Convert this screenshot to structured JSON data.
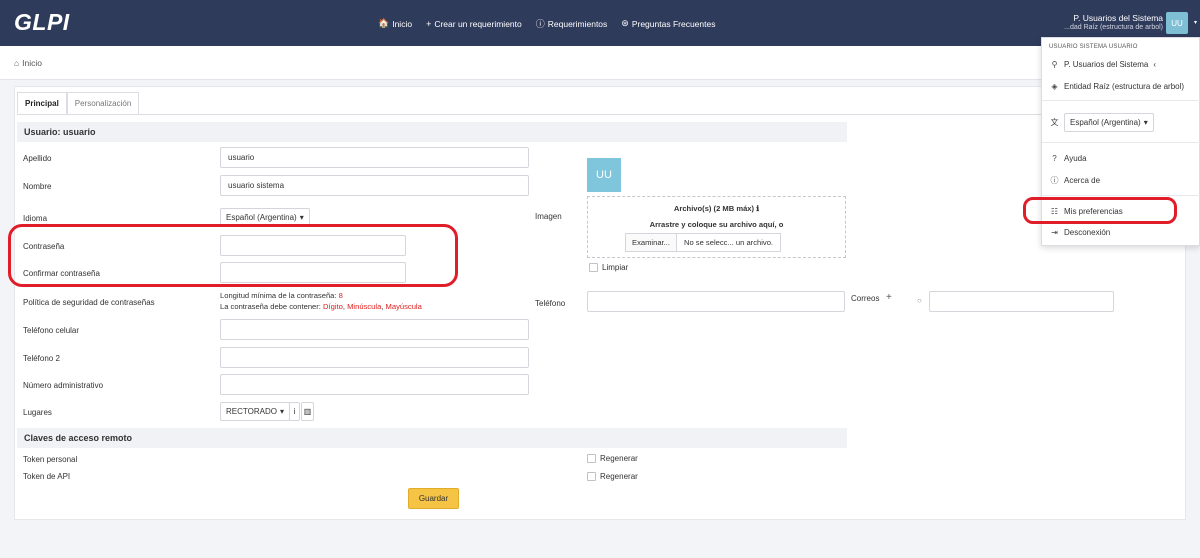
{
  "header": {
    "logo": "GLPI",
    "nav": [
      {
        "icon": "home-icon",
        "glyph": "🏠",
        "label": "Inicio"
      },
      {
        "icon": "plus-icon",
        "glyph": "+",
        "label": "Crear un requerimiento"
      },
      {
        "icon": "alert-circle-icon",
        "glyph": "ⓘ",
        "label": "Requerimientos"
      },
      {
        "icon": "faq-icon",
        "glyph": "⊛",
        "label": "Preguntas Frecuentes"
      }
    ],
    "user_name": "P. Usuarios del Sistema",
    "user_entity": "...dad Raíz (estructura de arbol)",
    "avatar": "UU"
  },
  "breadcrumb": {
    "home": "Inicio"
  },
  "tabs": [
    "Principal",
    "Personalización"
  ],
  "form": {
    "section_user": "Usuario: usuario",
    "labels": {
      "apellido": "Apellido",
      "nombre": "Nombre",
      "idioma": "Idioma",
      "password": "Contraseña",
      "confirm_password": "Confirmar contraseña",
      "policy": "Política de seguridad de contraseñas",
      "mobile": "Teléfono celular",
      "phone2": "Teléfono 2",
      "admin_number": "Número administrativo",
      "locations": "Lugares",
      "image": "Imagen",
      "phone": "Teléfono",
      "emails": "Correos"
    },
    "values": {
      "apellido": "usuario",
      "nombre": "usuario sistema",
      "idioma": "Español (Argentina)",
      "location": "RECTORADO"
    },
    "policy_min": "Longitud mínima de la contraseña:",
    "policy_min_value": "8",
    "policy_contains": "La contraseña debe contener:",
    "policy_digit": "Dígito",
    "policy_lower": "Minúscula",
    "policy_upper": "Mayúscula",
    "avatar": "UU",
    "upload_title": "Archivo(s) (2 MB máx)",
    "upload_hint": "Arrastre y coloque su archivo aquí, o",
    "browse_button": "Examinar...",
    "no_file": "No se selecc... un archivo.",
    "clear_label": "Limpiar",
    "section_remote": "Claves de acceso remoto",
    "personal_token": "Token personal",
    "api_token": "Token de API",
    "regenerate": "Regenerar",
    "save_button": "Guardar"
  },
  "user_menu": {
    "heading": "USUARIO SISTEMA USUARIO",
    "profile": "P. Usuarios del Sistema",
    "entity": "Entidad Raíz (estructura de arbol)",
    "language": "Español (Argentina)",
    "help": "Ayuda",
    "about": "Acerca de",
    "preferences": "Mis preferencias",
    "logout": "Desconexión"
  }
}
